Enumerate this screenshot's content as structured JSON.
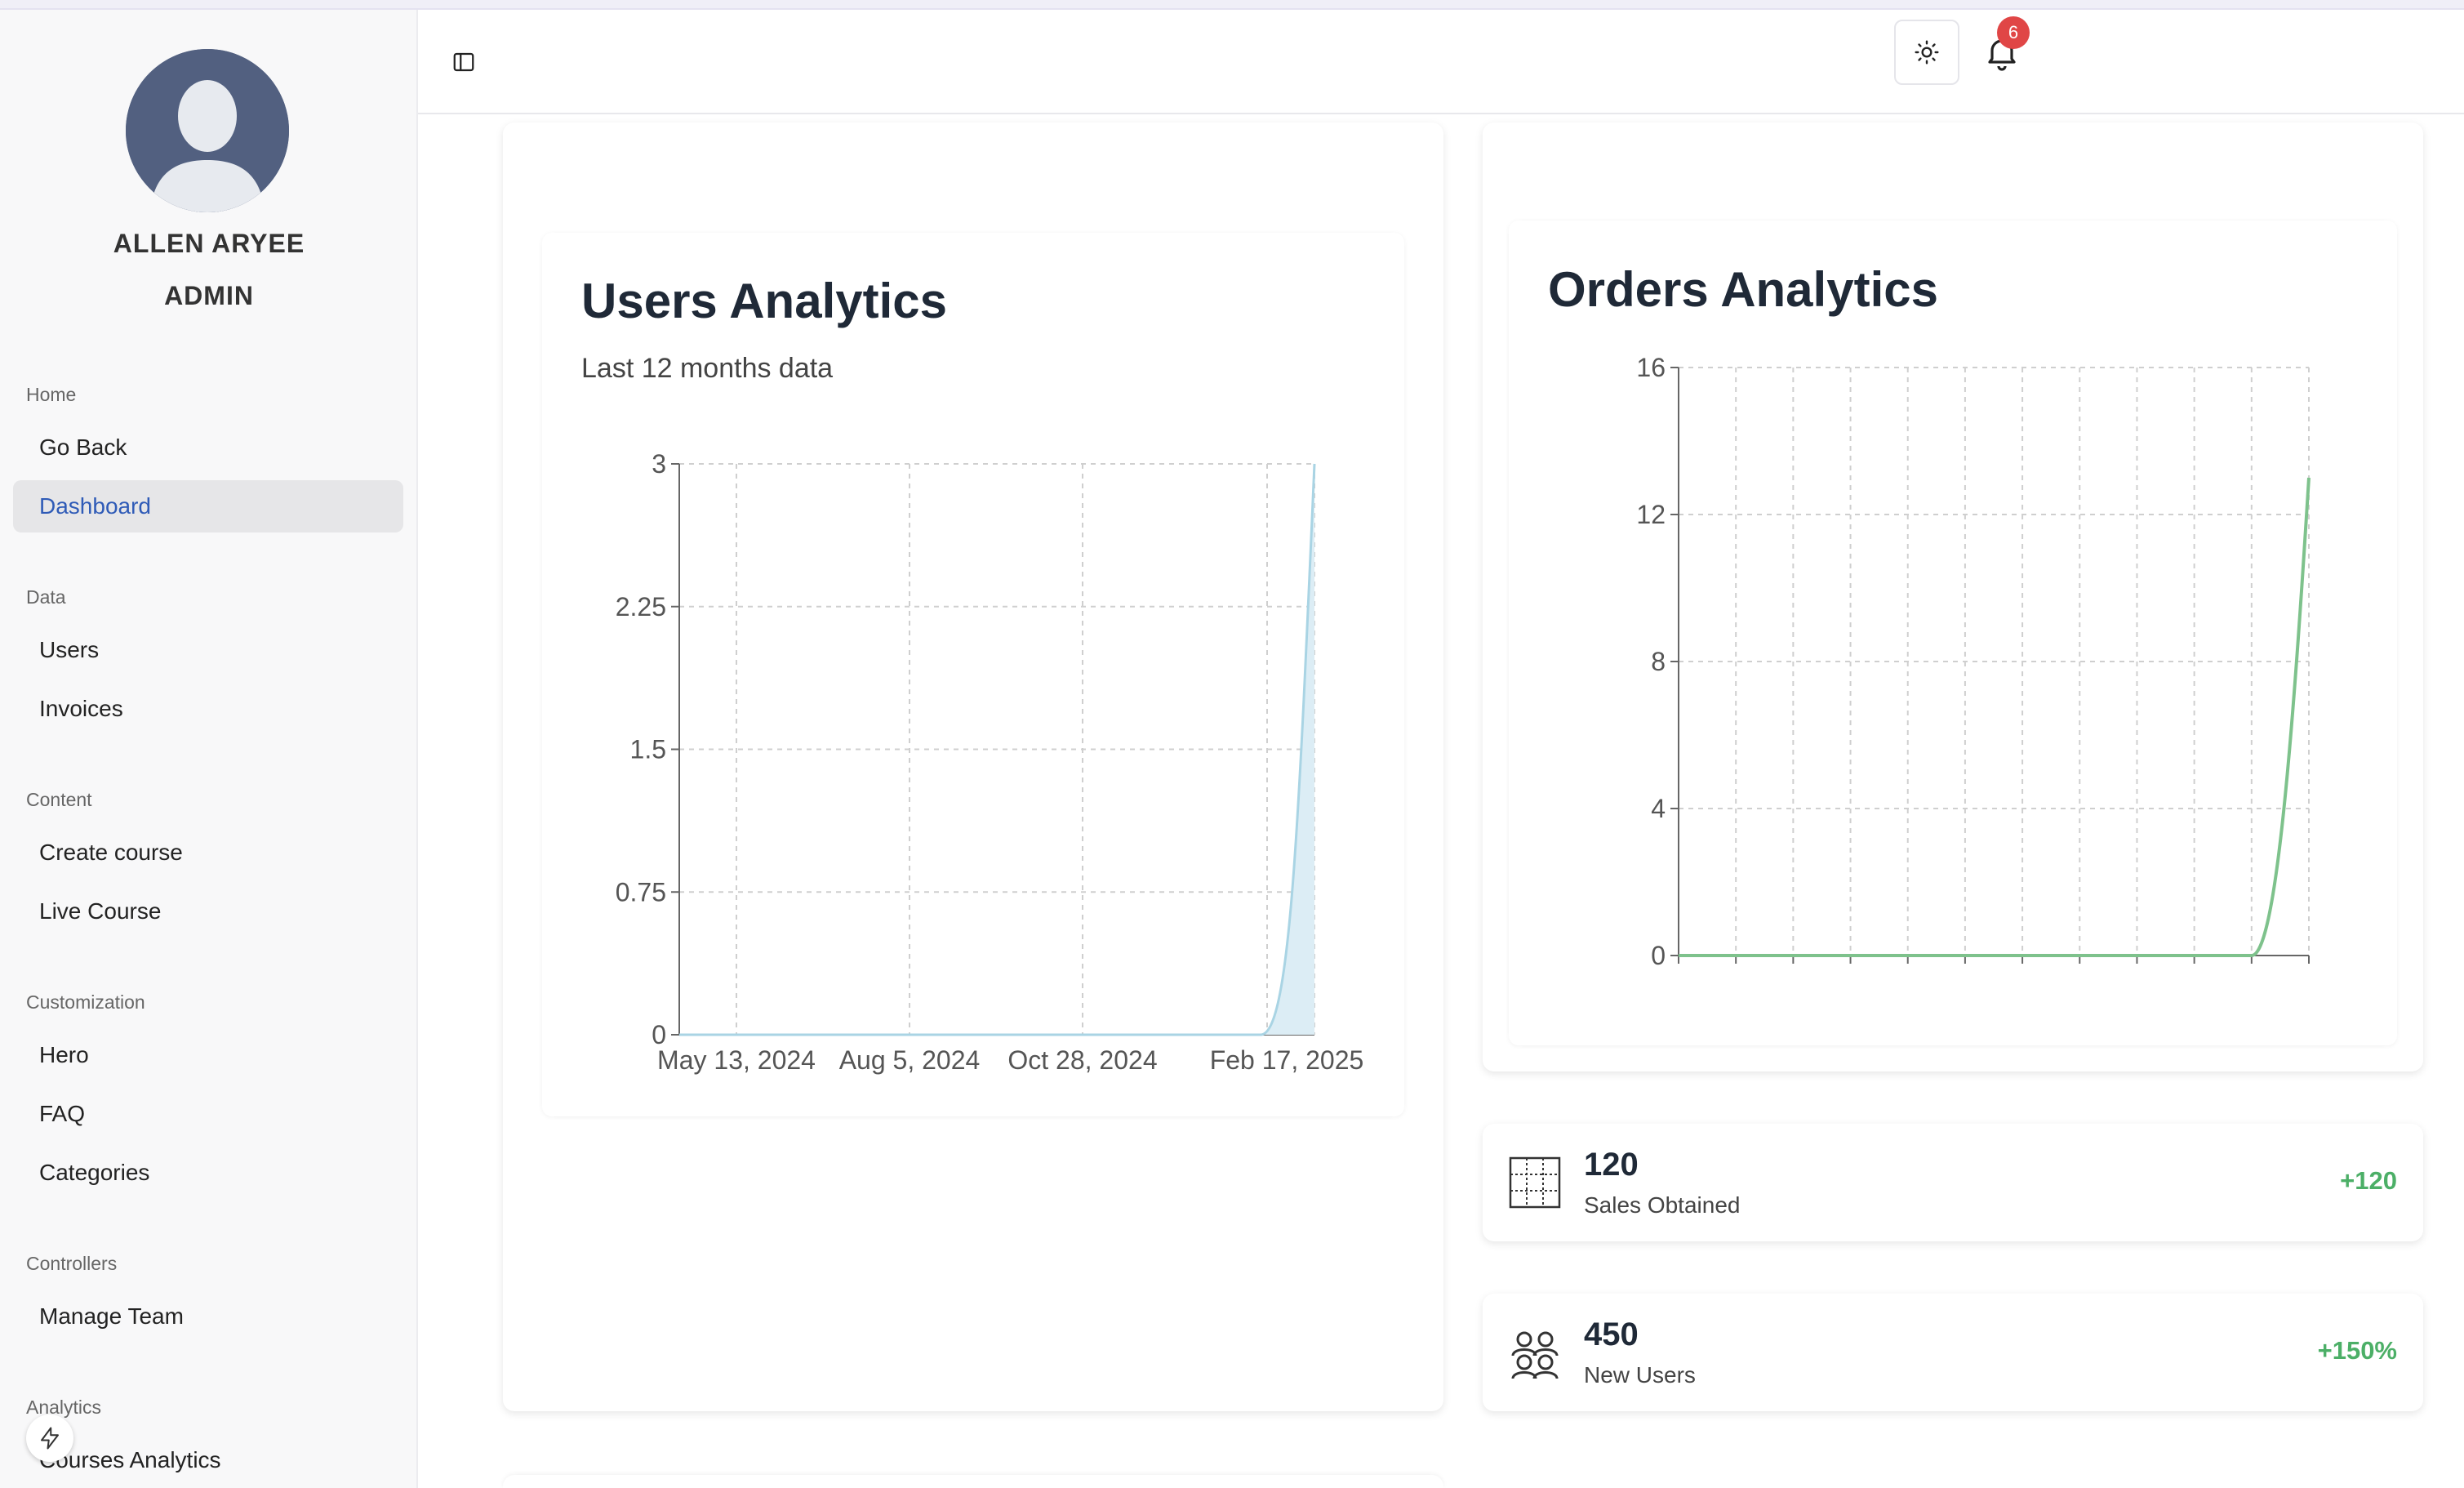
{
  "user": {
    "name": "ALLEN ARYEE",
    "role": "ADMIN"
  },
  "sidebar": {
    "sections": [
      {
        "label": "Home",
        "items": [
          {
            "label": "Go Back",
            "active": false
          },
          {
            "label": "Dashboard",
            "active": true
          }
        ]
      },
      {
        "label": "Data",
        "items": [
          {
            "label": "Users"
          },
          {
            "label": "Invoices"
          }
        ]
      },
      {
        "label": "Content",
        "items": [
          {
            "label": "Create course"
          },
          {
            "label": "Live Course"
          }
        ]
      },
      {
        "label": "Customization",
        "items": [
          {
            "label": "Hero"
          },
          {
            "label": "FAQ"
          },
          {
            "label": "Categories"
          }
        ]
      },
      {
        "label": "Controllers",
        "items": [
          {
            "label": "Manage Team"
          }
        ]
      },
      {
        "label": "Analytics",
        "items": [
          {
            "label": "Courses Analytics"
          }
        ]
      }
    ]
  },
  "header": {
    "notification_count": "6"
  },
  "users_analytics": {
    "title": "Users Analytics",
    "subtitle": "Last 12 months data"
  },
  "orders_analytics": {
    "title": "Orders Analytics"
  },
  "stats": [
    {
      "value": "120",
      "label": "Sales Obtained",
      "change": "+120",
      "icon": "table-grid-icon"
    },
    {
      "value": "450",
      "label": "New Users",
      "change": "+150%",
      "icon": "users-group-icon"
    }
  ],
  "colors": {
    "accent": "#2f5bb7",
    "users_line": "#a9d4e4",
    "users_fill": "#dcedf5",
    "orders_line": "#7ec28c",
    "positive": "#4caf67",
    "badge": "#e04646"
  },
  "chart_data": [
    {
      "type": "area",
      "x_ticks": [
        "May 13, 2024",
        "Aug 5, 2024",
        "Oct 28, 2024",
        "Feb 17, 2025"
      ],
      "y_ticks": [
        "0",
        "0.75",
        "1.5",
        "2.25",
        "3"
      ],
      "ylim": [
        0,
        3
      ],
      "x": [
        0,
        1,
        2,
        3,
        4,
        5,
        6,
        7,
        8,
        9,
        10,
        11
      ],
      "values": [
        0,
        0,
        0,
        0,
        0,
        0,
        0,
        0,
        0,
        0,
        0,
        3
      ],
      "grid": true
    },
    {
      "type": "line",
      "y_ticks": [
        "0",
        "4",
        "8",
        "12",
        "16"
      ],
      "ylim": [
        0,
        16
      ],
      "x": [
        0,
        1,
        2,
        3,
        4,
        5,
        6,
        7,
        8,
        9,
        10,
        11
      ],
      "values": [
        0,
        0,
        0,
        0,
        0,
        0,
        0,
        0,
        0,
        0,
        0,
        13
      ],
      "grid": true
    }
  ]
}
